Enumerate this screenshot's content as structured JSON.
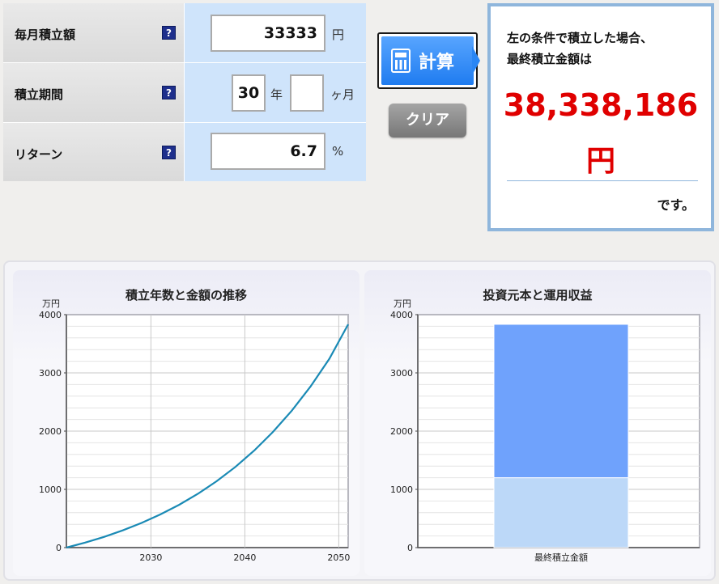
{
  "form": {
    "monthly": {
      "label": "毎月積立額",
      "value": "33333",
      "unit": "円"
    },
    "period": {
      "label": "積立期間",
      "years": "30",
      "years_unit": "年",
      "months": "",
      "months_unit": "ヶ月"
    },
    "return": {
      "label": "リターン",
      "value": "6.7",
      "unit": "%"
    },
    "help_glyph": "?"
  },
  "buttons": {
    "calc": "計算",
    "clear": "クリア"
  },
  "result": {
    "intro_line1": "左の条件で積立した場合、",
    "intro_line2": "最終積立金額は",
    "amount": "38,338,186",
    "currency": "円",
    "suffix": "です。",
    "color": "#e00000"
  },
  "colors": {
    "line": "#1a8ab5",
    "bar_principal": "#bcd8f8",
    "bar_return": "#6fa2fc"
  },
  "chart_data": [
    {
      "type": "line",
      "title": "積立年数と金額の推移",
      "ylabel": "万円",
      "ylim": [
        0,
        4000
      ],
      "yticks": [
        0,
        1000,
        2000,
        3000,
        4000
      ],
      "xlim": [
        2021,
        2051
      ],
      "xticks": [
        2030,
        2040,
        2050
      ],
      "series": [
        {
          "x": [
            2021,
            2023,
            2025,
            2027,
            2029,
            2031,
            2033,
            2035,
            2037,
            2039,
            2041,
            2043,
            2045,
            2047,
            2049,
            2051
          ],
          "values": [
            0,
            86,
            184,
            296,
            424,
            569,
            735,
            924,
            1140,
            1386,
            1667,
            1987,
            2352,
            2768,
            3243,
            3834
          ]
        }
      ]
    },
    {
      "type": "bar",
      "title": "投資元本と運用収益",
      "ylabel": "万円",
      "ylim": [
        0,
        4000
      ],
      "yticks": [
        0,
        1000,
        2000,
        3000,
        4000
      ],
      "categories": [
        "最終積立金額"
      ],
      "stacked": true,
      "series": [
        {
          "values": [
            1200
          ]
        },
        {
          "values": [
            2634
          ]
        }
      ]
    }
  ]
}
